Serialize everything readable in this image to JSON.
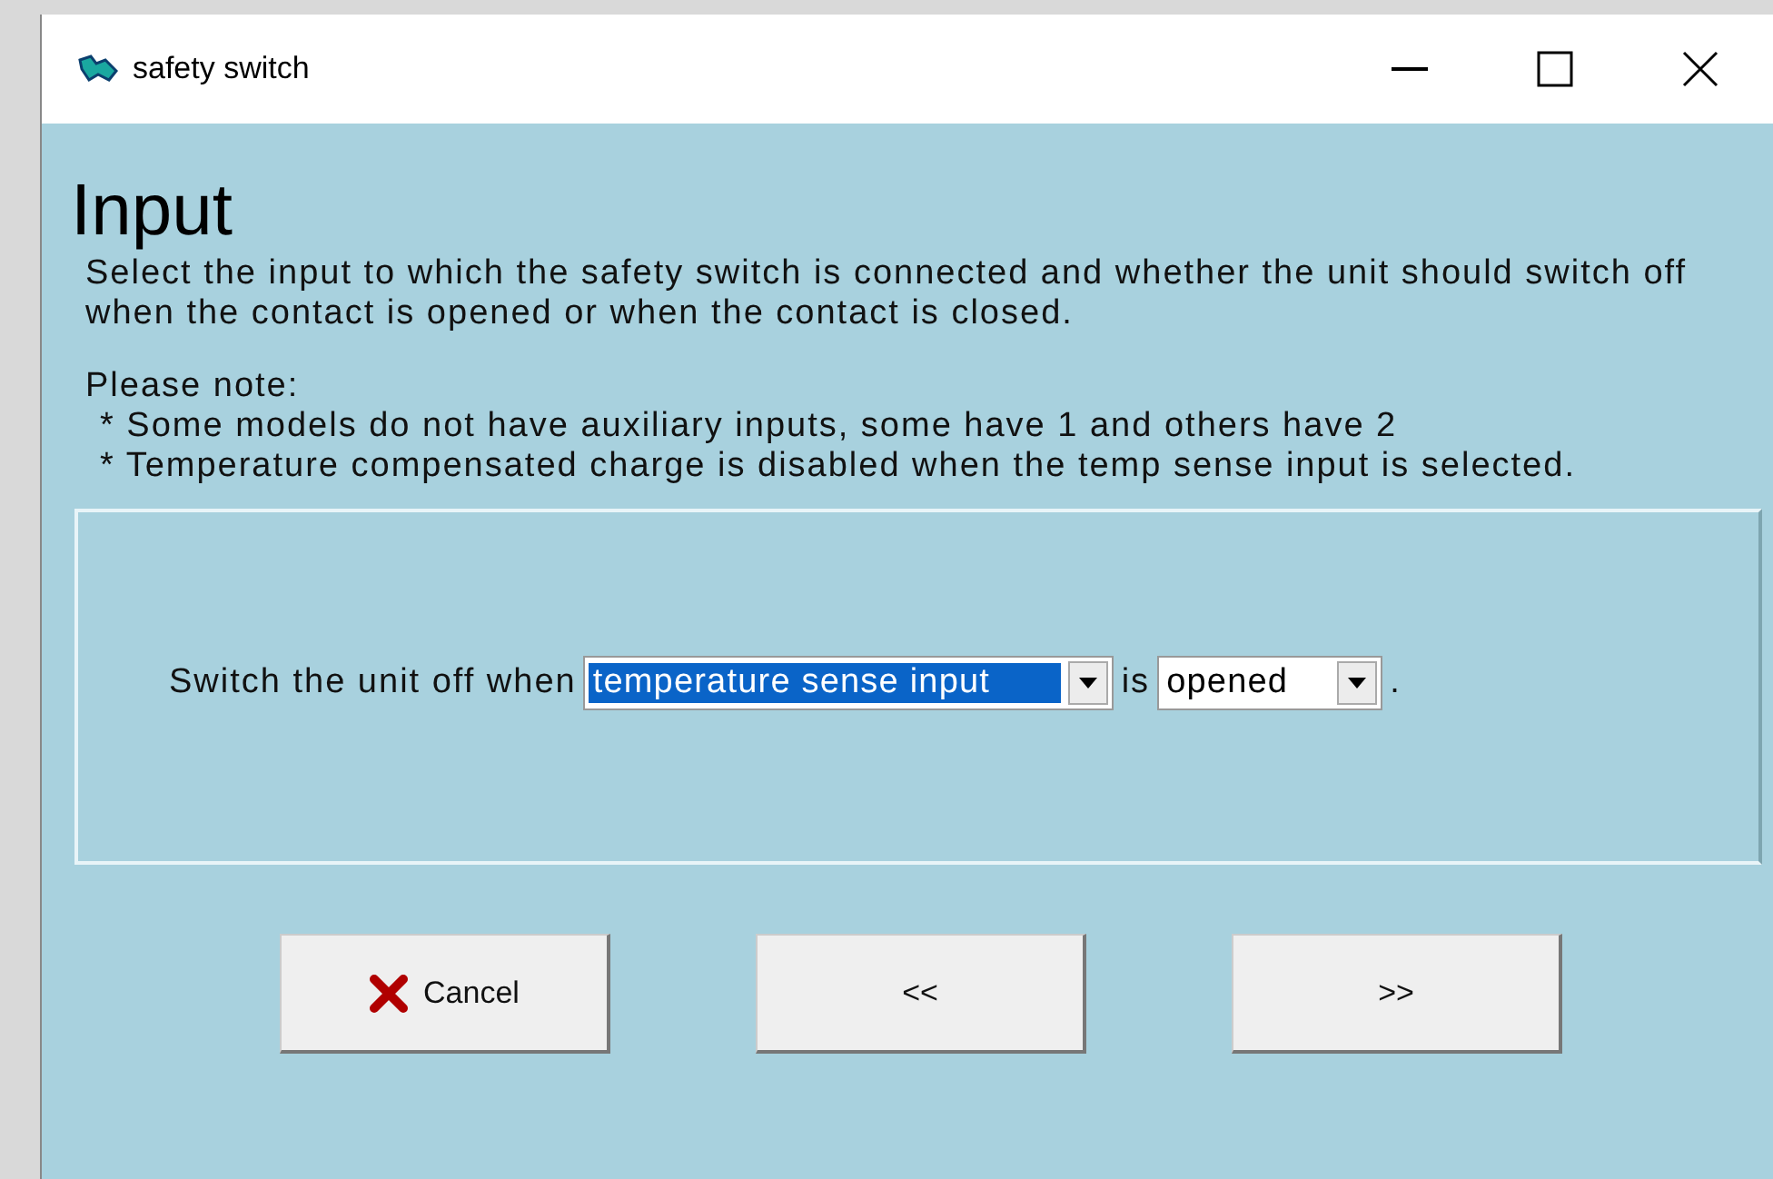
{
  "window": {
    "title": "safety switch"
  },
  "heading": "Input",
  "description": "Select the input to which the safety switch is connected and whether the unit should switch off when the contact is opened or when the contact is closed.",
  "note_title": "Please note:",
  "notes": [
    "* Some models do not have auxiliary inputs, some have 1 and others have 2",
    "* Temperature compensated charge is disabled when the temp sense input is selected."
  ],
  "sentence": {
    "lead": "Switch the unit off when",
    "input_select": {
      "value": "temperature sense input",
      "highlighted": true
    },
    "middle": "is",
    "state_select": {
      "value": "opened",
      "highlighted": false
    },
    "end": "."
  },
  "buttons": [
    {
      "kind": "cancel",
      "label": "Cancel"
    },
    {
      "kind": "plain",
      "label": "<<"
    },
    {
      "kind": "plain",
      "label": ">>"
    }
  ]
}
